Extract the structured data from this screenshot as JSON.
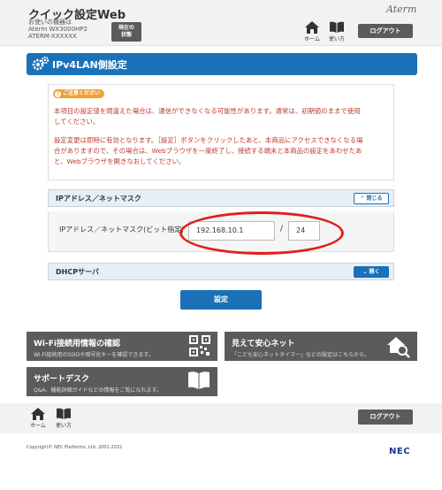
{
  "header": {
    "app_title": "クイック設定Web",
    "device_label": "お使いの機器は",
    "device_model": "Aterm WX3000HP2",
    "device_id": "ATERM-XXXXXX",
    "status_button": [
      "現在の",
      "状態"
    ],
    "brand": "Aterm",
    "home_label": "ホーム",
    "manual_label": "使い方",
    "logout_label": "ログアウト"
  },
  "panel": {
    "title": "IPv4LAN側設定",
    "notice": {
      "badge": "ご注意ください",
      "lines": [
        "本項目の設定値を間違えた場合は、通信ができなくなる可能性があります。通常は、初期値のままで使用",
        "してください。",
        "設定変更は即時に有効となります。［設定］ボタンをクリックしたあと、本商品にアクセスできなくなる場",
        "合がありますので、その場合は、Webブラウザを一度終了し、接続する端末と本商品の設定をあわせたあ",
        "と、Webブラウザを開きなおしてください。"
      ]
    },
    "ip_section": {
      "title": "IPアドレス／ネットマスク",
      "toggle": "閉じる",
      "field_label": "IPアドレス／ネットマスク(ビット指定)",
      "ip_value": "192.168.10.1",
      "separator": "/",
      "mask_value": "24"
    },
    "dhcp_section": {
      "title": "DHCPサーバ",
      "toggle": "開く"
    },
    "set_button": "設定"
  },
  "tiles": [
    {
      "title": "Wi-Fi接続用情報の確認",
      "desc": "Wi-Fi接続用のSSIDや暗号化キーを確認できます。",
      "icon": "qr-code-icon"
    },
    {
      "title": "見えて安心ネット",
      "desc": "「こども安心ネットタイマー」などの設定はこちらから。",
      "icon": "home-search-icon"
    },
    {
      "title": "サポートデスク",
      "desc": "Q&A、機能詳細ガイドなどの情報をご覧になれます。",
      "icon": "book-icon"
    }
  ],
  "footer": {
    "home_label": "ホーム",
    "manual_label": "使い方",
    "logout_label": "ログアウト",
    "copyright": "Copyright© NEC Platforms, Ltd. 2001-2022",
    "logo": "NEC"
  },
  "colors": {
    "accent_blue": "#1b71b8",
    "tile_gray": "#5b5b5b",
    "warning_red": "#c0392b",
    "notice_orange": "#f2a033",
    "highlight_red": "#e0201a"
  }
}
